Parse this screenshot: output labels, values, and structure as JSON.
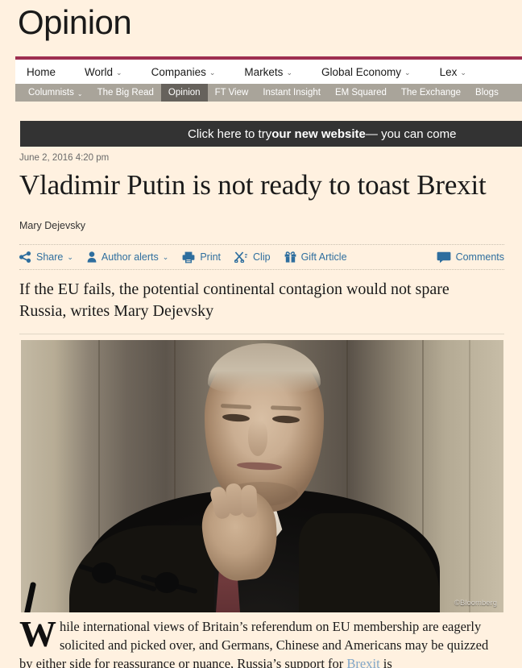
{
  "section": {
    "title": "Opinion"
  },
  "nav": {
    "primary": [
      {
        "label": "Home",
        "has_caret": false
      },
      {
        "label": "World",
        "has_caret": true
      },
      {
        "label": "Companies",
        "has_caret": true
      },
      {
        "label": "Markets",
        "has_caret": true
      },
      {
        "label": "Global Economy",
        "has_caret": true
      },
      {
        "label": "Lex",
        "has_caret": true
      }
    ],
    "secondary": [
      {
        "label": "Columnists",
        "has_caret": true,
        "active": false
      },
      {
        "label": "The Big Read",
        "has_caret": false,
        "active": false
      },
      {
        "label": "Opinion",
        "has_caret": false,
        "active": true
      },
      {
        "label": "FT View",
        "has_caret": false,
        "active": false
      },
      {
        "label": "Instant Insight",
        "has_caret": false,
        "active": false
      },
      {
        "label": "EM Squared",
        "has_caret": false,
        "active": false
      },
      {
        "label": "The Exchange",
        "has_caret": false,
        "active": false
      },
      {
        "label": "Blogs",
        "has_caret": false,
        "active": false
      }
    ],
    "caret_glyph": "⌄",
    "accent_color": "#9e2f50",
    "secondary_bg": "#a9a49a",
    "secondary_active_bg": "#66625c"
  },
  "promo": {
    "text_before": "Click here to try ",
    "text_bold": "our new website",
    "text_after": " — you can come",
    "background": "#333333"
  },
  "article": {
    "timestamp": "June 2, 2016 4:20 pm",
    "headline": "Vladimir Putin is not ready to toast Brexit",
    "byline": "Mary Dejevsky",
    "standfirst": "If the EU fails, the potential continental contagion would not spare Russia, writes Mary Dejevsky",
    "image_credit": "©Bloomberg",
    "body": {
      "dropcap": "W",
      "text_1": "hile international views of Britain’s referendum on EU membership are eagerly solicited and picked over, and Germans, Chinese and Americans may be quizzed by either side for reassurance or nuance, Russia’s support for ",
      "link_text": "Brexit",
      "text_2": " is"
    }
  },
  "tools": {
    "share": {
      "label": "Share",
      "icon": "share-icon",
      "has_caret": true
    },
    "author_alerts": {
      "label": "Author alerts",
      "icon": "person-icon",
      "has_caret": true
    },
    "print": {
      "label": "Print",
      "icon": "printer-icon",
      "has_caret": false
    },
    "clip": {
      "label": "Clip",
      "icon": "scissors-icon",
      "has_caret": false
    },
    "gift": {
      "label": "Gift Article",
      "icon": "gift-icon",
      "has_caret": false
    },
    "comments": {
      "label": "Comments",
      "icon": "speech-bubble-icon",
      "has_caret": false
    },
    "link_color": "#2e6e9e",
    "caret_glyph": "⌄"
  },
  "colors": {
    "page_background": "#fff1e0",
    "text": "#1a1a1a",
    "muted_text": "#6a6a6a",
    "body_link": "#7fa6c9"
  }
}
